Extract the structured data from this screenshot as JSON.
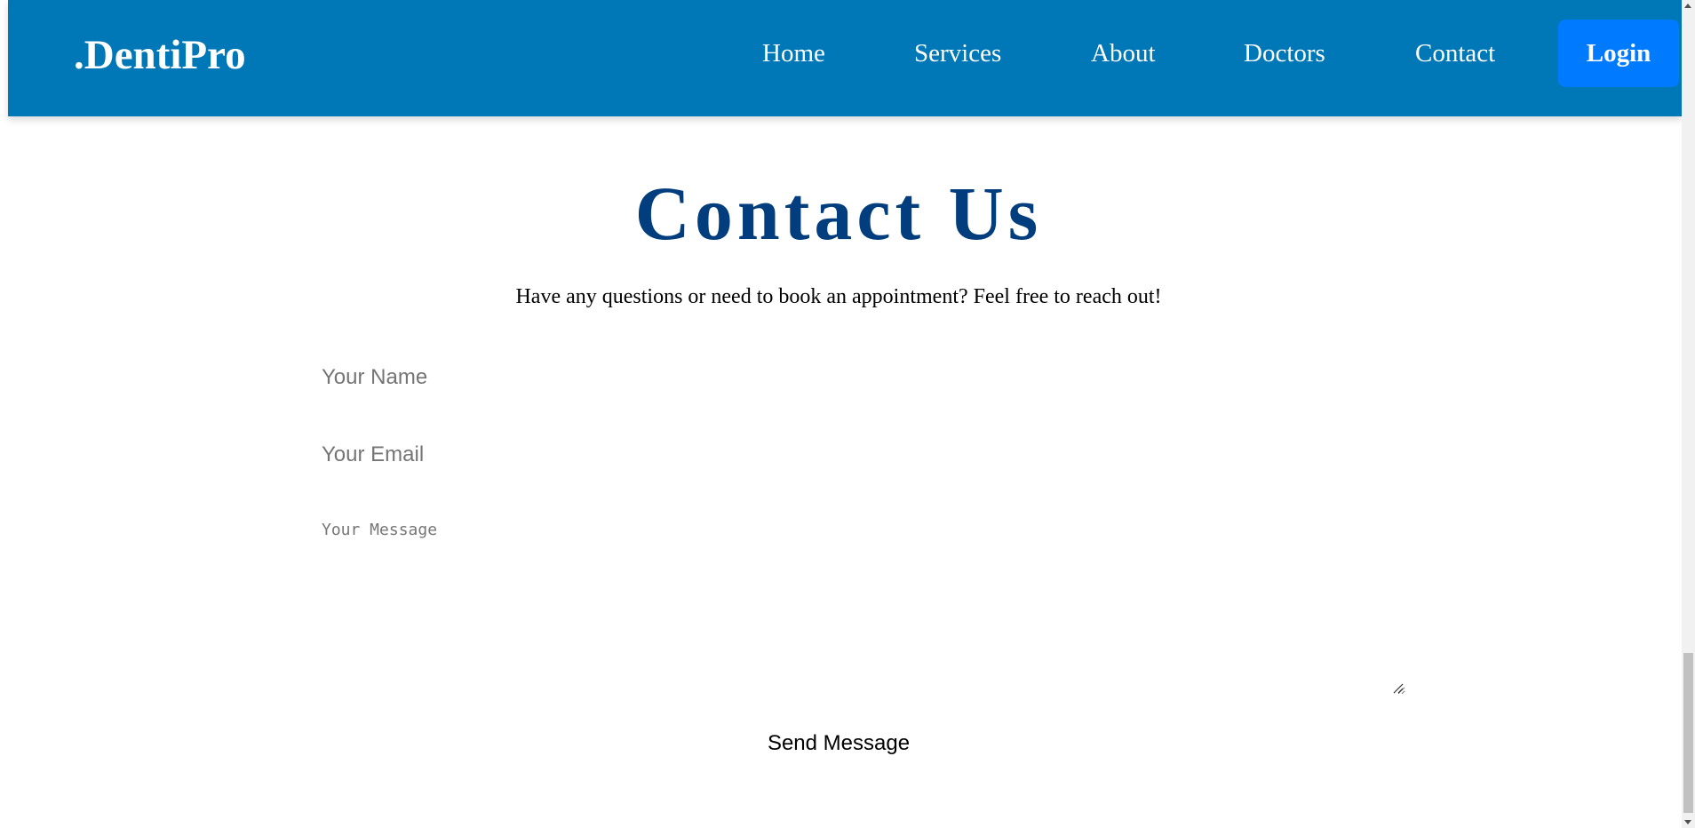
{
  "header": {
    "logo": ".DentiPro",
    "nav": {
      "home": "Home",
      "services": "Services",
      "about": "About",
      "doctors": "Doctors",
      "contact": "Contact"
    },
    "login_label": "Login"
  },
  "contact": {
    "title": "Contact Us",
    "subtitle": "Have any questions or need to book an appointment? Feel free to reach out!",
    "name_placeholder": "Your Name",
    "email_placeholder": "Your Email",
    "message_placeholder": "Your Message",
    "submit_label": "Send Message"
  },
  "colors": {
    "header_bg": "#0077b6",
    "login_bg": "#007bff",
    "title": "#023e7d"
  }
}
